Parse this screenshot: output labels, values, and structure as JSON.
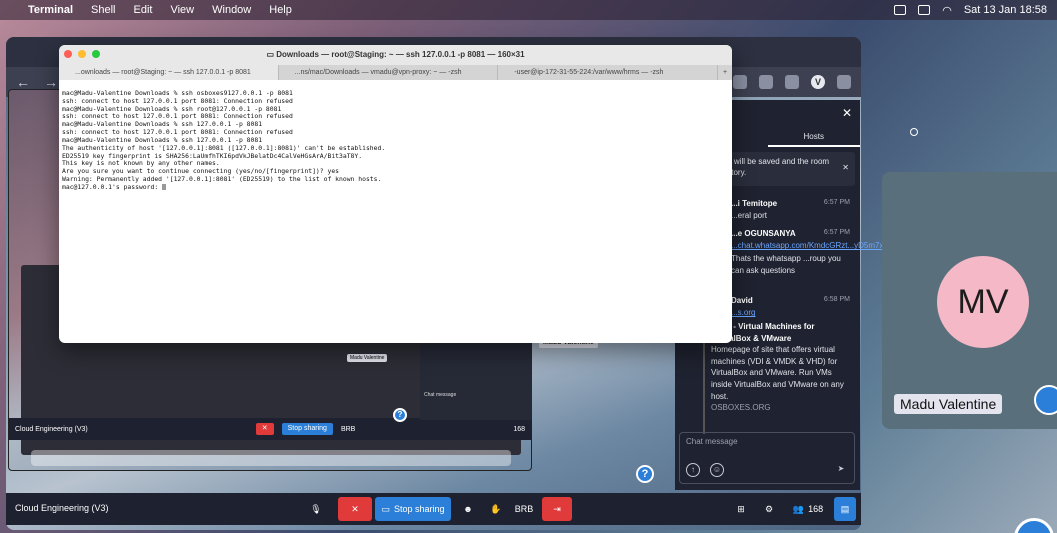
{
  "menubar": {
    "app": "Terminal",
    "items": [
      "Shell",
      "Edit",
      "View",
      "Window",
      "Help"
    ],
    "clock": "Sat 13 Jan  18:58"
  },
  "terminal": {
    "title": "Downloads — root@Staging: ~ — ssh 127.0.0.1 -p 8081 — 160×31",
    "tabs": [
      "...ownloads — root@Staging: ~ — ssh 127.0.0.1 -p 8081",
      "...ns/mac/Downloads — vmadu@vpn-proxy: ~ — -zsh",
      "-user@ip-172-31-55-224:/var/www/hrms — -zsh"
    ],
    "lines": [
      "mac@Madu-Valentine Downloads % ssh osboxes9127.0.0.1 -p 8081",
      "ssh: connect to host 127.0.0.1 port 8081: Connection refused",
      "mac@Madu-Valentine Downloads % ssh root@127.0.0.1 -p 8081",
      "ssh: connect to host 127.0.0.1 port 8081: Connection refused",
      "mac@Madu-Valentine Downloads % ssh 127.0.0.1 -p 8081",
      "ssh: connect to host 127.0.0.1 port 8081: Connection refused",
      "mac@Madu-Valentine Downloads % ssh 127.0.0.1 -p 8081",
      "The authenticity of host '[127.0.0.1]:8081 ([127.0.0.1]:8081)' can't be established.",
      "ED25519 key fingerprint is SHA256:LaUmfhTKI6pdVkJBelatDc4CalVeHGsArA/Bit3aT8Y.",
      "This key is not known by any other names.",
      "Are you sure you want to continue connecting (yes/no/[fingerprint])? yes",
      "Warning: Permanently added '[127.0.0.1]:8081' (ED25519) to the list of known hosts.",
      "mac@127.0.0.1's password: "
    ]
  },
  "browser": {
    "record_label": "Record"
  },
  "chat_panel": {
    "tab_hosts": "Hosts",
    "notice": "...s will be saved and the room history.",
    "messages": [
      {
        "author": "...i Temitope",
        "time": "6:57 PM",
        "text": "...eral port"
      },
      {
        "author": "...e OGUNSANYA",
        "time": "6:57 PM",
        "link": "...chat.whatsapp.com/KmdcGRzt...yD5m7x4",
        "text": "Thats the whatsapp ...roup you can ask questions"
      },
      {
        "author": "David",
        "time": "6:58 PM",
        "link": "...s.org"
      }
    ],
    "preview": {
      "title": "...xes - Virtual Machines for VirtualBox & VMware",
      "body": "Homepage of site that offers virtual machines (VDI & VMDK & VHD) for VirtualBox and VMware. Run VMs inside VirtualBox and VMware on any host.",
      "site": "OSBOXES.ORG"
    },
    "input_placeholder": "Chat message"
  },
  "toolbar": {
    "room_name": "Cloud Engineering (V3)",
    "share_label": "Stop sharing",
    "brb_label": "BRB",
    "people_count": "168"
  },
  "nested": {
    "room_name": "Cloud Engineering (V3)",
    "name_label": "Madu Valentine",
    "chip_label": "Madu Valentine",
    "chat_placeholder": "Chat message",
    "share_label": "Stop sharing",
    "brb_label": "BRB",
    "people_count": "168"
  },
  "participant": {
    "initials": "MV",
    "name": "Madu Valentine"
  }
}
